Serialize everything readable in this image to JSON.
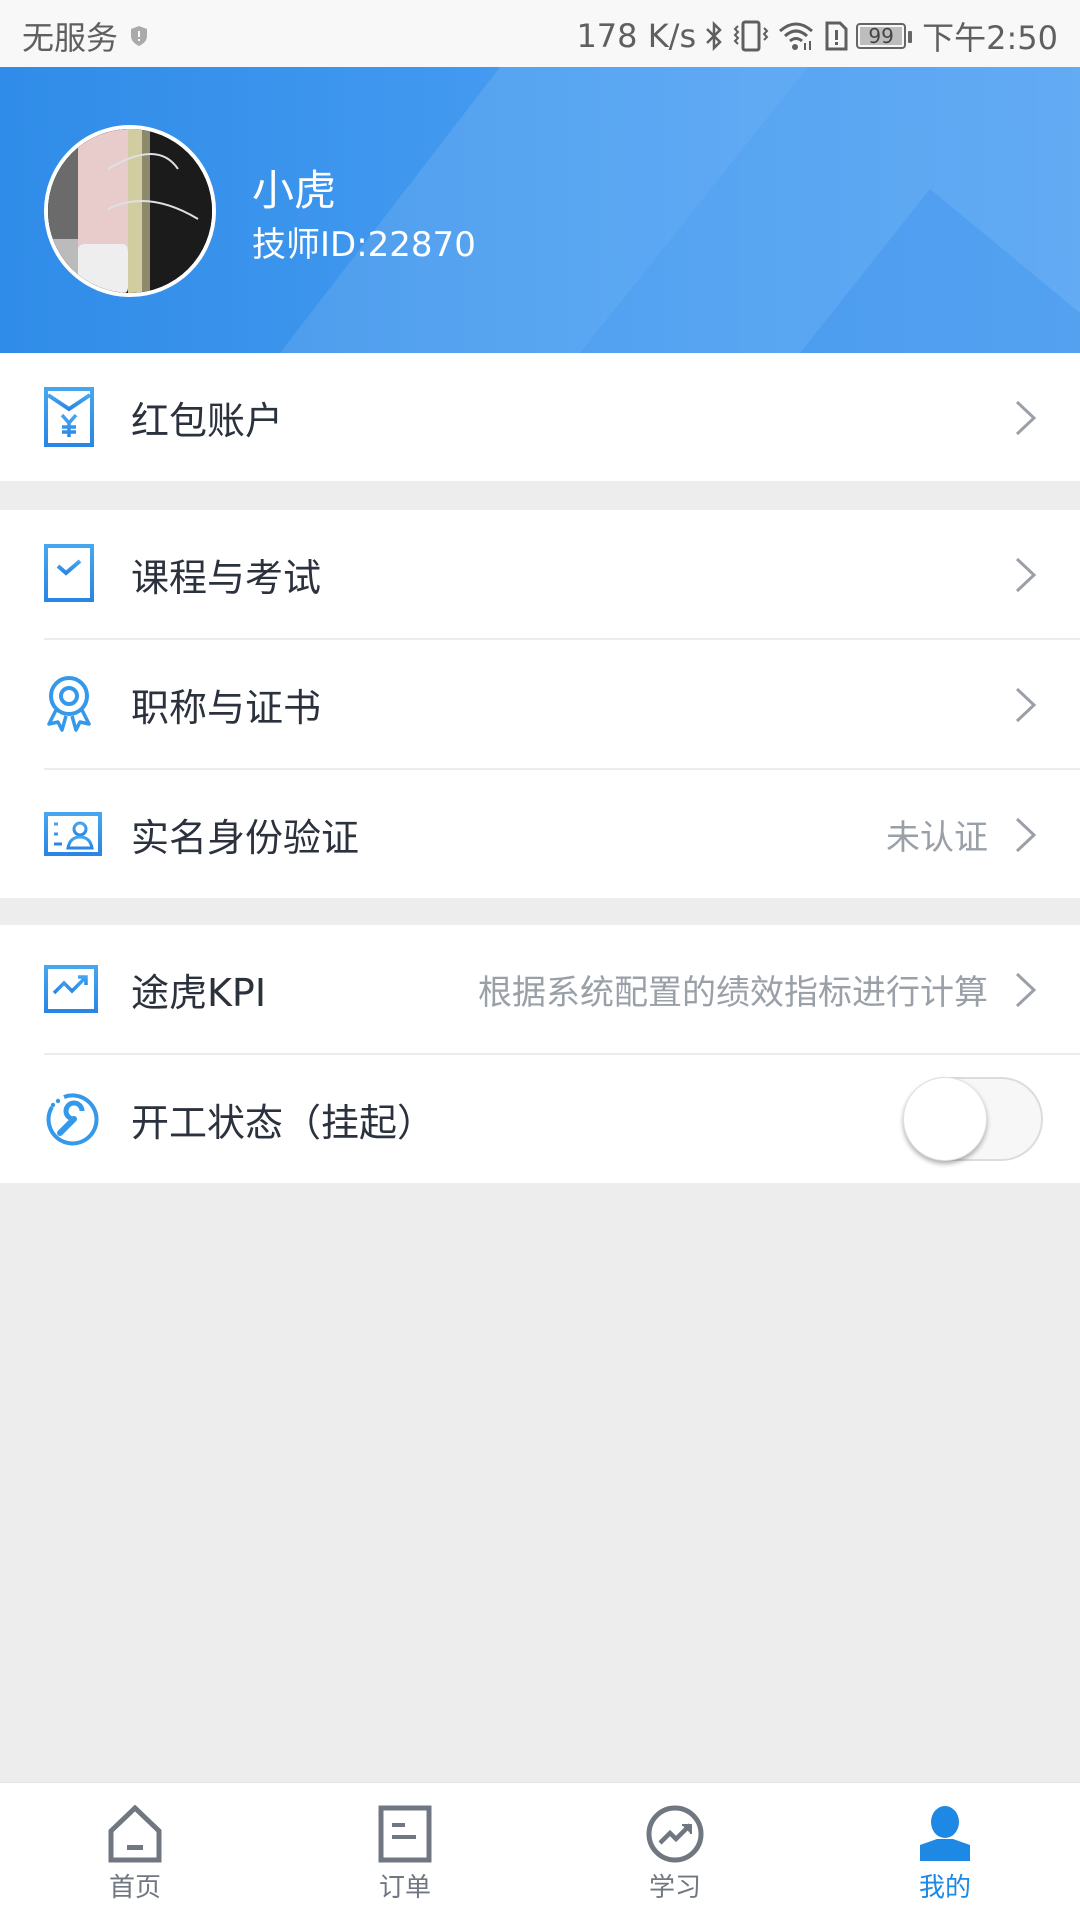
{
  "status_bar": {
    "carrier": "无服务",
    "net_speed": "178 K/s",
    "battery": "99",
    "time": "下午2:50",
    "icons": [
      "shield-alert-icon",
      "bluetooth-icon",
      "vibrate-icon",
      "wifi-icon",
      "sim-alert-icon",
      "battery-icon"
    ]
  },
  "profile": {
    "name": "小虎",
    "technician_id": "技师ID:22870",
    "colors": {
      "header_start": "#2f8ce8",
      "header_end": "#5aa6f3"
    }
  },
  "menu": {
    "groups": [
      {
        "items": [
          {
            "label": "红包账户",
            "icon": "red-envelope-icon",
            "value": ""
          }
        ]
      },
      {
        "items": [
          {
            "label": "课程与考试",
            "icon": "course-exam-icon",
            "value": ""
          },
          {
            "label": "职称与证书",
            "icon": "certificate-badge-icon",
            "value": ""
          },
          {
            "label": "实名身份验证",
            "icon": "id-card-icon",
            "value": "未认证"
          }
        ]
      },
      {
        "items": [
          {
            "label": "途虎KPI",
            "icon": "kpi-chart-icon",
            "value": "根据系统配置的绩效指标进行计算"
          },
          {
            "label": "开工状态（挂起）",
            "icon": "wrench-status-icon",
            "toggle": false
          }
        ]
      }
    ]
  },
  "bottom_nav": {
    "items": [
      {
        "label": "首页",
        "icon": "home-icon",
        "active": false
      },
      {
        "label": "订单",
        "icon": "order-icon",
        "active": false
      },
      {
        "label": "学习",
        "icon": "learning-trend-icon",
        "active": false
      },
      {
        "label": "我的",
        "icon": "user-icon",
        "active": true
      }
    ],
    "colors": {
      "active": "#1e88e5",
      "inactive": "#707780"
    }
  },
  "colors": {
    "accent": "#2a8ae6",
    "text": "#2b323d",
    "secondary_text": "#9aa0a8",
    "background": "#ededed"
  }
}
